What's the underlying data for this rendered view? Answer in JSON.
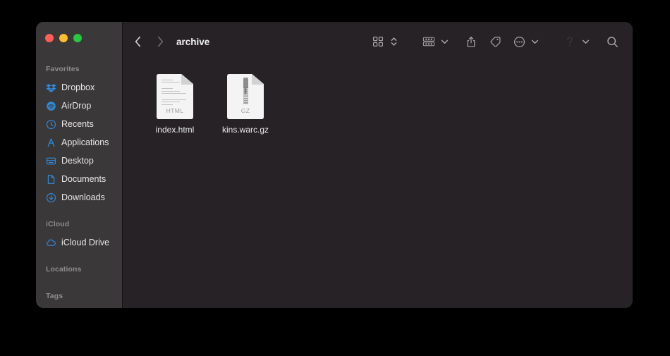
{
  "window": {
    "title": "archive",
    "traffic_lights": [
      {
        "name": "close",
        "color": "#ff5f57"
      },
      {
        "name": "minimize",
        "color": "#febc2e"
      },
      {
        "name": "maximize",
        "color": "#28c840"
      }
    ]
  },
  "toolbar": {
    "back_label": "‹",
    "forward_label": "›",
    "buttons": [
      {
        "name": "view-mode-icon-view",
        "icon": "grid-icon"
      },
      {
        "name": "view-mode-selector",
        "icon": "chevron-updown-icon"
      },
      {
        "name": "group-items",
        "icon": "group-icon"
      },
      {
        "name": "group-items-chevron",
        "icon": "chevron-down-icon"
      },
      {
        "name": "share",
        "icon": "share-icon"
      },
      {
        "name": "tags",
        "icon": "tag-icon"
      },
      {
        "name": "more-actions",
        "icon": "ellipsis-circle-icon"
      },
      {
        "name": "more-actions-chevron",
        "icon": "chevron-down-icon"
      },
      {
        "name": "dimmed-action",
        "icon": "dimmed-icon"
      },
      {
        "name": "dimmed-action-chevron",
        "icon": "chevron-down-icon"
      },
      {
        "name": "search",
        "icon": "search-icon"
      }
    ]
  },
  "sidebar": {
    "sections": [
      {
        "header": "Favorites",
        "items": [
          {
            "label": "Dropbox",
            "icon": "dropbox-icon"
          },
          {
            "label": "AirDrop",
            "icon": "airdrop-icon"
          },
          {
            "label": "Recents",
            "icon": "clock-icon"
          },
          {
            "label": "Applications",
            "icon": "applications-icon"
          },
          {
            "label": "Desktop",
            "icon": "desktop-icon"
          },
          {
            "label": "Documents",
            "icon": "document-icon"
          },
          {
            "label": "Downloads",
            "icon": "download-icon"
          }
        ]
      },
      {
        "header": "iCloud",
        "items": [
          {
            "label": "iCloud Drive",
            "icon": "cloud-icon"
          }
        ]
      },
      {
        "header": "Locations",
        "items": []
      },
      {
        "header": "Tags",
        "items": []
      }
    ]
  },
  "content": {
    "files": [
      {
        "name": "index.html",
        "kind": "HTML",
        "type": "document"
      },
      {
        "name": "kins.warc.gz",
        "kind": "GZ",
        "type": "archive"
      }
    ]
  },
  "colors": {
    "window_bg": "#262225",
    "sidebar_bg": "#3a3839",
    "accent": "#2f8de4",
    "text": "#ececec",
    "muted_text": "#8e8c8d"
  }
}
